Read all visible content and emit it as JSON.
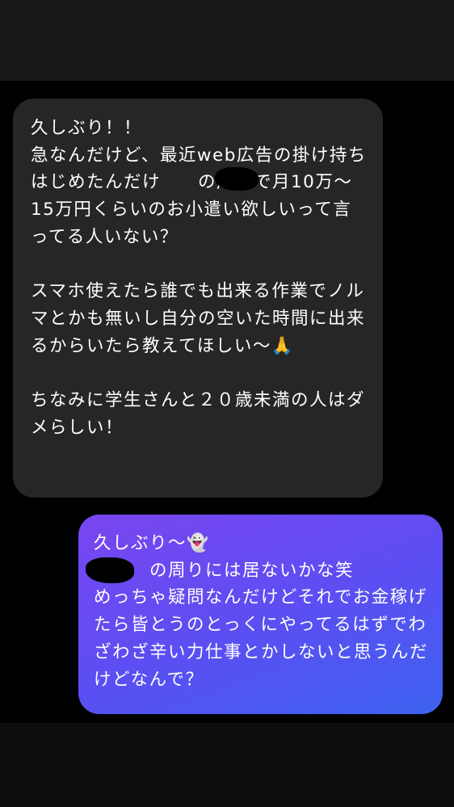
{
  "conversation": {
    "incoming_message": {
      "text": "久しぶり！！\n急なんだけど、最近web広告の掛け持ちはじめたんだけ　　の周りで月10万〜15万円くらいのお小遣い欲しいって言ってる人いない？\n\nスマホ使えたら誰でも出来る作業でノルマとかも無いし自分の空いた時間に出来るからいたら教えてほしい〜🙏\n\nちなみに学生さんと２０歳未満の人はダメらしい！"
    },
    "outgoing_message": {
      "text": "久しぶり〜👻\n　　　の周りには居ないかな笑\nめっちゃ疑問なんだけどそれでお金稼げたら皆とうのとっくにやってるはずでわざわざ辛い力仕事とかしないと思うんだけどなんで？"
    }
  },
  "colors": {
    "background": "#000000",
    "top_bar": "#181818",
    "incoming_bubble": "#262626",
    "outgoing_gradient_start": "#7a45f0",
    "outgoing_gradient_end": "#3d62ef",
    "text": "#ffffff",
    "redaction": "#000000"
  }
}
